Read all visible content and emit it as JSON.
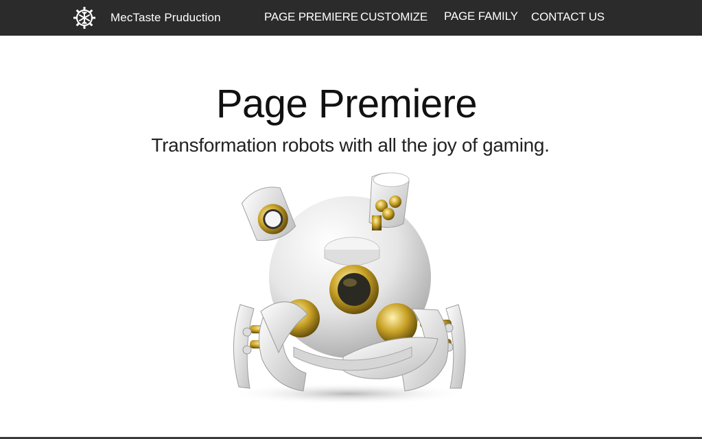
{
  "header": {
    "brand_name": "MecTaste Pruduction",
    "logo_icon": "gear-snowflake-icon",
    "nav": [
      {
        "label": "PAGE PREMIERE"
      },
      {
        "label": "CUSTOMIZE"
      },
      {
        "label": "PAGE FAMILY"
      },
      {
        "label": "CONTACT US"
      }
    ]
  },
  "hero": {
    "title": "Page Premiere",
    "subtitle": "Transformation robots with all the joy of gaming."
  },
  "colors": {
    "header_bg": "#2b2b2b",
    "header_text": "#ffffff",
    "page_bg": "#ffffff",
    "robot_shell": "#e8e8e8",
    "robot_gold": "#c9a227"
  }
}
